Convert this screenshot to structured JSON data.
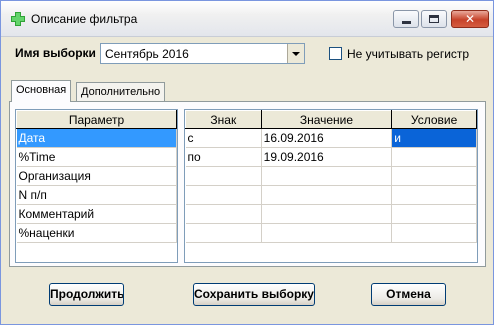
{
  "window": {
    "title": "Описание фильтра"
  },
  "filter": {
    "name_label": "Имя выборки",
    "name_value": "Сентябрь 2016",
    "ignore_case_label": "Не учитывать регистр"
  },
  "tabs": [
    {
      "label": "Основная"
    },
    {
      "label": "Дополнительно"
    }
  ],
  "params": {
    "header": "Параметр",
    "rows": [
      "Дата",
      "%Time",
      "Организация",
      "N п/п",
      "Комментарий",
      "%наценки"
    ]
  },
  "conditions": {
    "headers": [
      "Знак",
      "Значение",
      "Условие"
    ],
    "rows": [
      {
        "sign": "с",
        "value": "16.09.2016",
        "cond": "и"
      },
      {
        "sign": "по",
        "value": "19.09.2016",
        "cond": ""
      }
    ]
  },
  "buttons": {
    "continue": "Продолжить",
    "save": "Сохранить выборку",
    "cancel": "Отмена"
  }
}
